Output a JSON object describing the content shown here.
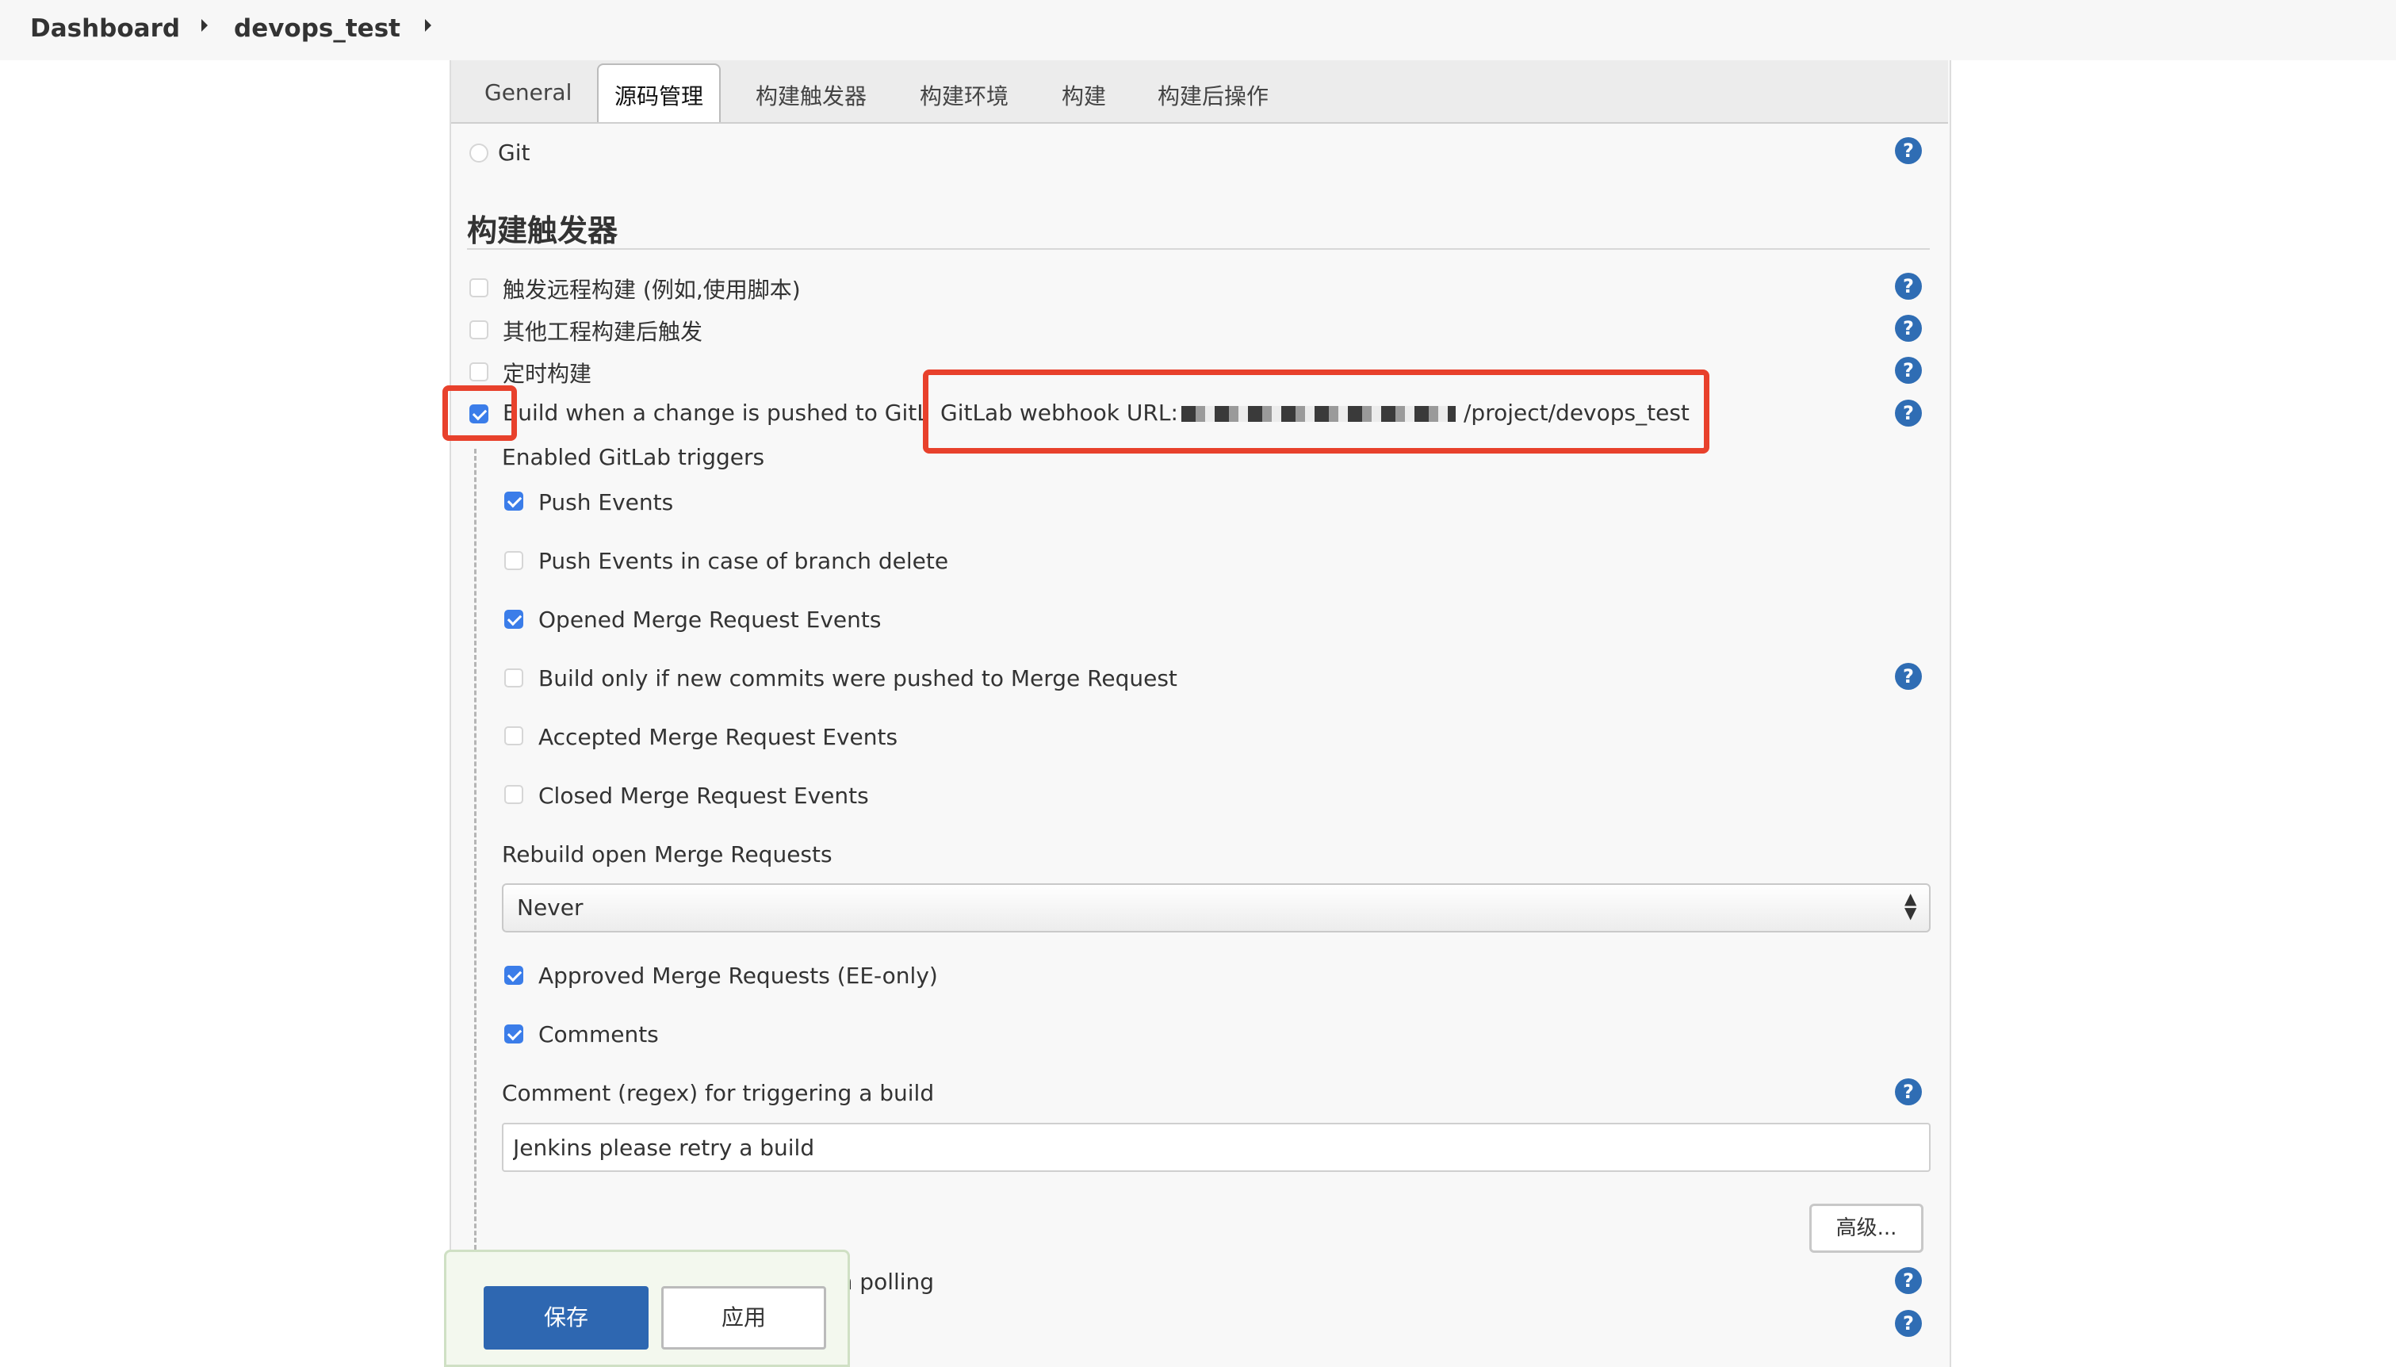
{
  "breadcrumb": {
    "root": "Dashboard",
    "project": "devops_test"
  },
  "tabs": [
    {
      "label": "General"
    },
    {
      "label": "源码管理"
    },
    {
      "label": "构建触发器"
    },
    {
      "label": "构建环境"
    },
    {
      "label": "构建"
    },
    {
      "label": "构建后操作"
    }
  ],
  "scm": {
    "git_label": "Git"
  },
  "triggers": {
    "heading": "构建触发器",
    "remote_label": "触发远程构建 (例如,使用脚本)",
    "after_other_label": "其他工程构建后触发",
    "periodic_label": "定时构建",
    "gitlab_push_label": "Build when a change is pushed to GitLab.",
    "webhook_prefix": "GitLab webhook URL:",
    "webhook_suffix": "/project/devops_test",
    "gitlab_push_checked": true
  },
  "gitlab": {
    "enabled_triggers_label": "Enabled GitLab triggers",
    "push_events": {
      "label": "Push Events",
      "checked": true
    },
    "push_branch_delete": {
      "label": "Push Events in case of branch delete",
      "checked": false
    },
    "opened_mr": {
      "label": "Opened Merge Request Events",
      "checked": true
    },
    "build_only_new_commits": {
      "label": "Build only if new commits were pushed to Merge Request",
      "checked": false
    },
    "accepted_mr": {
      "label": "Accepted Merge Request Events",
      "checked": false
    },
    "closed_mr": {
      "label": "Closed Merge Request Events",
      "checked": false
    },
    "rebuild_label": "Rebuild open Merge Requests",
    "rebuild_value": "Never",
    "approved_mr": {
      "label": "Approved Merge Requests (EE-only)",
      "checked": true
    },
    "comments": {
      "label": "Comments",
      "checked": true
    },
    "comment_regex_label": "Comment (regex) for triggering a build",
    "comment_regex_value": "Jenkins please retry a build",
    "advanced_label": "高级..."
  },
  "github_polling_label": "GitHub hook trigger for GITScm polling",
  "actions": {
    "save_label": "保存",
    "apply_label": "应用"
  },
  "colors": {
    "accent": "#2e67b1",
    "highlight": "#e8412c",
    "checkbox": "#3b7de9"
  }
}
